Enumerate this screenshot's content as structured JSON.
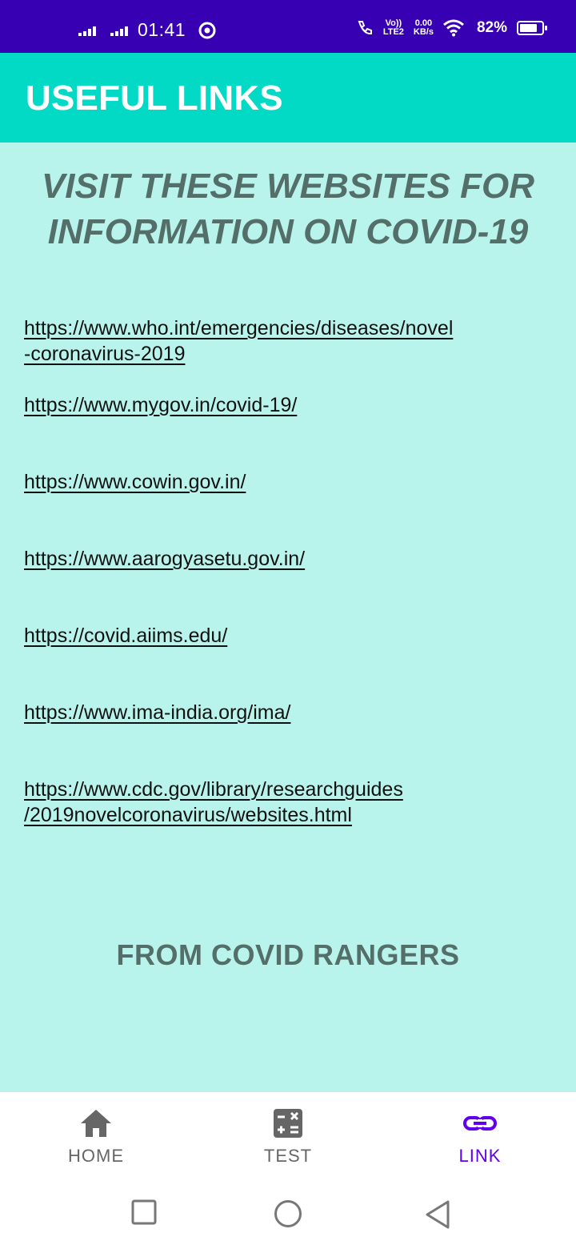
{
  "status_bar": {
    "time": "01:41",
    "volte_top": "Vo))",
    "volte_bottom": "LTE2",
    "speed_top": "0.00",
    "speed_bottom": "KB/s",
    "battery": "82%",
    "battery_level": 0.82
  },
  "app_bar": {
    "title": "USEFUL LINKS"
  },
  "content": {
    "heading_line1": "VISIT THESE WEBSITES FOR",
    "heading_line2": "INFORMATION ON COVID-19",
    "links": [
      "https://www.who.int/emergencies/diseases/novel\n-coronavirus-2019",
      "https://www.mygov.in/covid-19/",
      "https://www.cowin.gov.in/",
      "https://www.aarogyasetu.gov.in/",
      "https://covid.aiims.edu/",
      "https://www.ima-india.org/ima/",
      "https://www.cdc.gov/library/researchguides\n/2019novelcoronavirus/websites.html"
    ],
    "footer_note": "FROM COVID RANGERS"
  },
  "bottom_nav": {
    "items": [
      {
        "label": "HOME",
        "icon": "home-icon"
      },
      {
        "label": "TEST",
        "icon": "calculator-icon"
      },
      {
        "label": "LINK",
        "icon": "link-icon"
      }
    ],
    "active": "LINK",
    "active_color": "#6200ee"
  },
  "colors": {
    "status_bar": "#3700b3",
    "app_bar": "#03dac5",
    "background": "#b9f4ec",
    "heading": "#546e6a"
  }
}
